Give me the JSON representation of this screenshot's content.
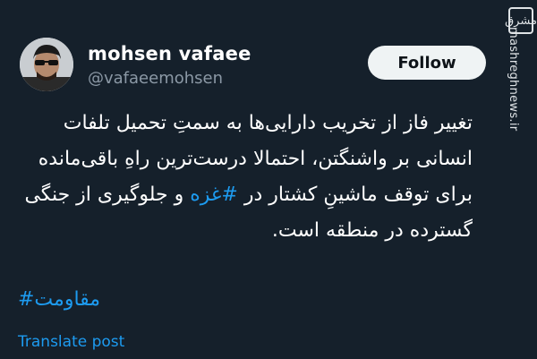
{
  "user": {
    "name": "mohsen vafaee",
    "handle": "@vafaeemohsen"
  },
  "actions": {
    "follow_label": "Follow",
    "translate_label": "Translate post"
  },
  "tweet": {
    "line1": "تغییر فاز از تخریب دارایی‌ها به سمتِ تحمیل تلفات",
    "line2": "انسانی بر واشنگتن، احتمالا درست‌ترین راهِ باقی‌مانده",
    "line3_before": "برای توقف ماشینِ کشتار در ",
    "line3_hashtag": "#غزه",
    "line3_after": " و جلوگیری از جنگی",
    "line4": "گسترده در منطقه است."
  },
  "hashtag_line": "مقاومت#",
  "watermark": {
    "logo_text": "مشرق",
    "url": "mashreghnews.ir"
  },
  "colors": {
    "background": "#15202b",
    "link": "#1d9bf0",
    "button": "#eff3f4"
  },
  "icons": [
    "avatar-photo",
    "mashregh-logo-icon"
  ]
}
